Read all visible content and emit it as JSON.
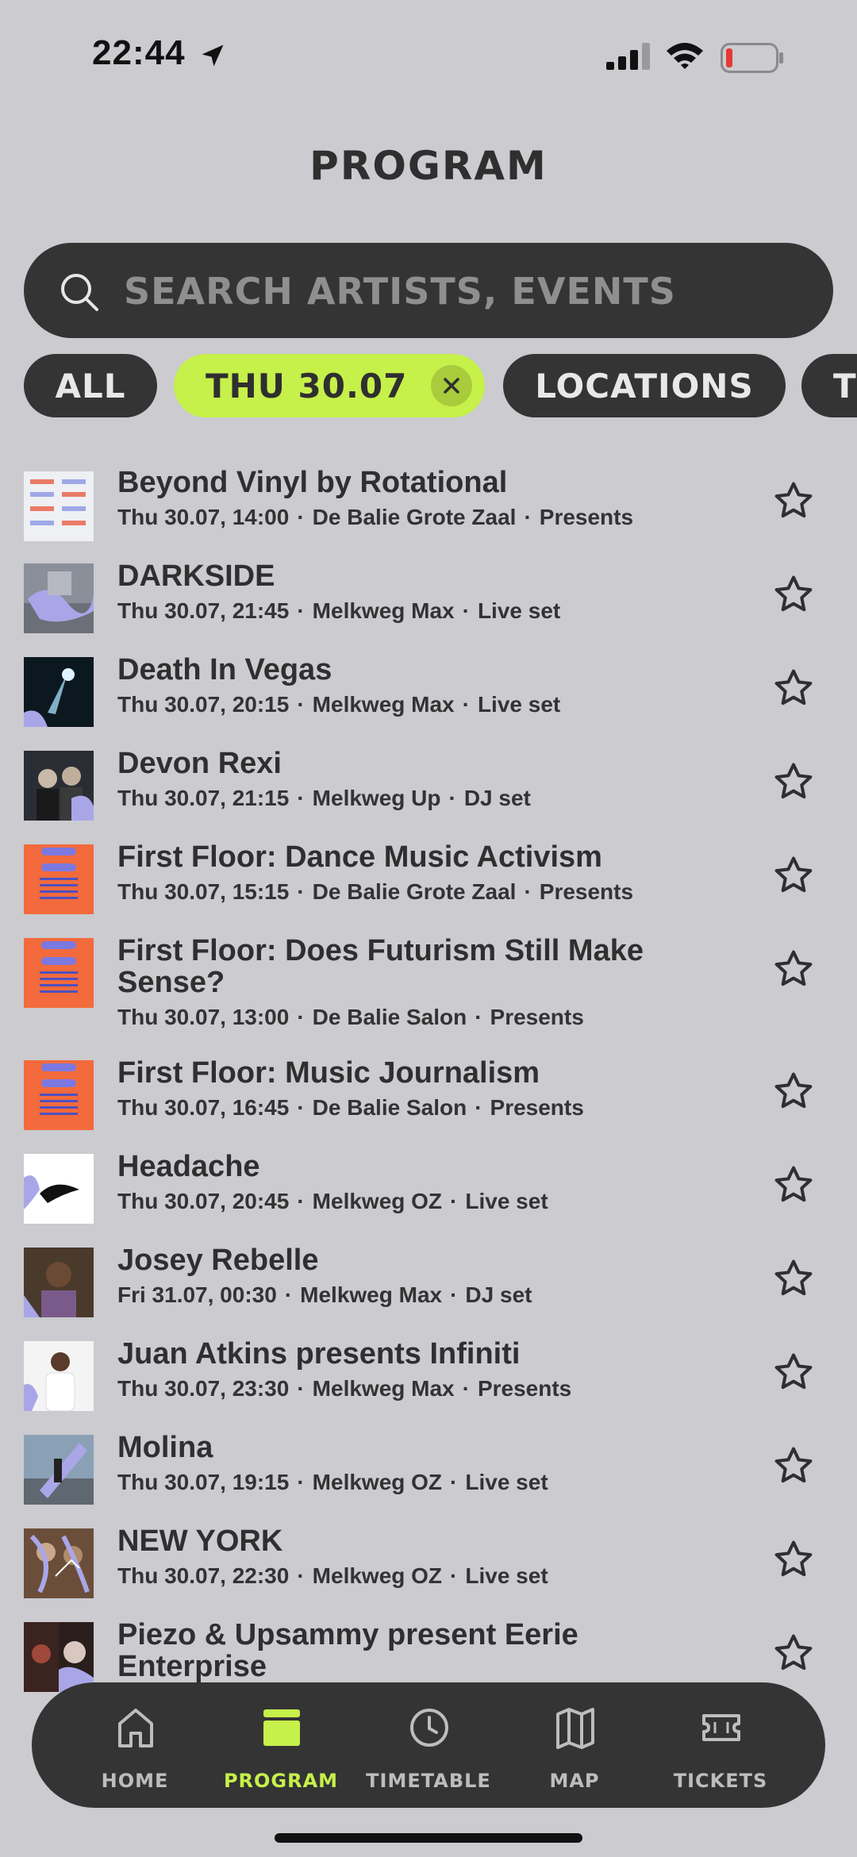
{
  "status_bar": {
    "time": "22:44"
  },
  "header": {
    "title": "PROGRAM"
  },
  "search": {
    "placeholder": "SEARCH ARTISTS, EVENTS"
  },
  "filters": [
    {
      "label": "ALL"
    },
    {
      "label": "THU 30.07",
      "active": true
    },
    {
      "label": "LOCATIONS"
    },
    {
      "label": "T"
    }
  ],
  "events": [
    {
      "title": "Beyond Vinyl by Rotational",
      "date": "Thu 30.07, 14:00",
      "venue": "De Balie Grote Zaal",
      "type": "Presents"
    },
    {
      "title": "DARKSIDE",
      "date": "Thu 30.07, 21:45",
      "venue": "Melkweg Max",
      "type": "Live set"
    },
    {
      "title": "Death In Vegas",
      "date": "Thu 30.07, 20:15",
      "venue": "Melkweg Max",
      "type": "Live set"
    },
    {
      "title": "Devon Rexi",
      "date": "Thu 30.07, 21:15",
      "venue": "Melkweg Up",
      "type": "DJ set"
    },
    {
      "title": "First Floor: Dance Music Activism",
      "date": "Thu 30.07, 15:15",
      "venue": "De Balie Grote Zaal",
      "type": "Presents"
    },
    {
      "title": "First Floor: Does Futurism Still Make Sense?",
      "date": "Thu 30.07, 13:00",
      "venue": "De Balie Salon",
      "type": "Presents"
    },
    {
      "title": "First Floor: Music Journalism",
      "date": "Thu 30.07, 16:45",
      "venue": "De Balie Salon",
      "type": "Presents"
    },
    {
      "title": "Headache",
      "date": "Thu 30.07, 20:45",
      "venue": "Melkweg OZ",
      "type": "Live set"
    },
    {
      "title": "Josey Rebelle",
      "date": "Fri 31.07, 00:30",
      "venue": "Melkweg Max",
      "type": "DJ set"
    },
    {
      "title": "Juan Atkins presents Infiniti",
      "date": "Thu 30.07, 23:30",
      "venue": "Melkweg Max",
      "type": "Presents"
    },
    {
      "title": "Molina",
      "date": "Thu 30.07, 19:15",
      "venue": "Melkweg OZ",
      "type": "Live set"
    },
    {
      "title": "NEW YORK",
      "date": "Thu 30.07, 22:30",
      "venue": "Melkweg OZ",
      "type": "Live set"
    },
    {
      "title": "Piezo & Upsammy present Eerie Enterprise",
      "date": "",
      "venue": "",
      "type": ""
    }
  ],
  "tabs": [
    {
      "label": "HOME",
      "icon": "home-icon"
    },
    {
      "label": "PROGRAM",
      "icon": "program-icon",
      "active": true
    },
    {
      "label": "TIMETABLE",
      "icon": "clock-icon"
    },
    {
      "label": "MAP",
      "icon": "map-icon"
    },
    {
      "label": "TICKETS",
      "icon": "ticket-icon"
    }
  ],
  "colors": {
    "accent": "#c6f04a",
    "dark": "#343434",
    "background": "#cbcbd0"
  }
}
